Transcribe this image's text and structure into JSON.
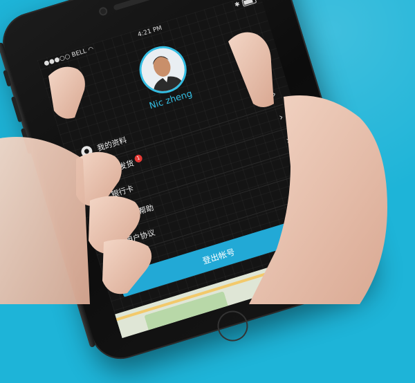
{
  "status_bar": {
    "carrier": "BELL",
    "time": "4:21 PM"
  },
  "profile": {
    "name": "Nic zheng"
  },
  "menu": {
    "items": [
      {
        "label": "我的资料",
        "icon": "person-icon"
      },
      {
        "label": "我的发货",
        "icon": "truck-icon",
        "badge": "1"
      },
      {
        "label": "银行卡",
        "icon": "card-icon"
      },
      {
        "label": "客服&帮助",
        "icon": "chat-icon"
      },
      {
        "label": "用户协议",
        "icon": "document-icon"
      }
    ]
  },
  "actions": {
    "logout_label": "登出帐号"
  },
  "colors": {
    "background": "#1eb4d8",
    "accent": "#22a9d6",
    "badge": "#e53935"
  }
}
